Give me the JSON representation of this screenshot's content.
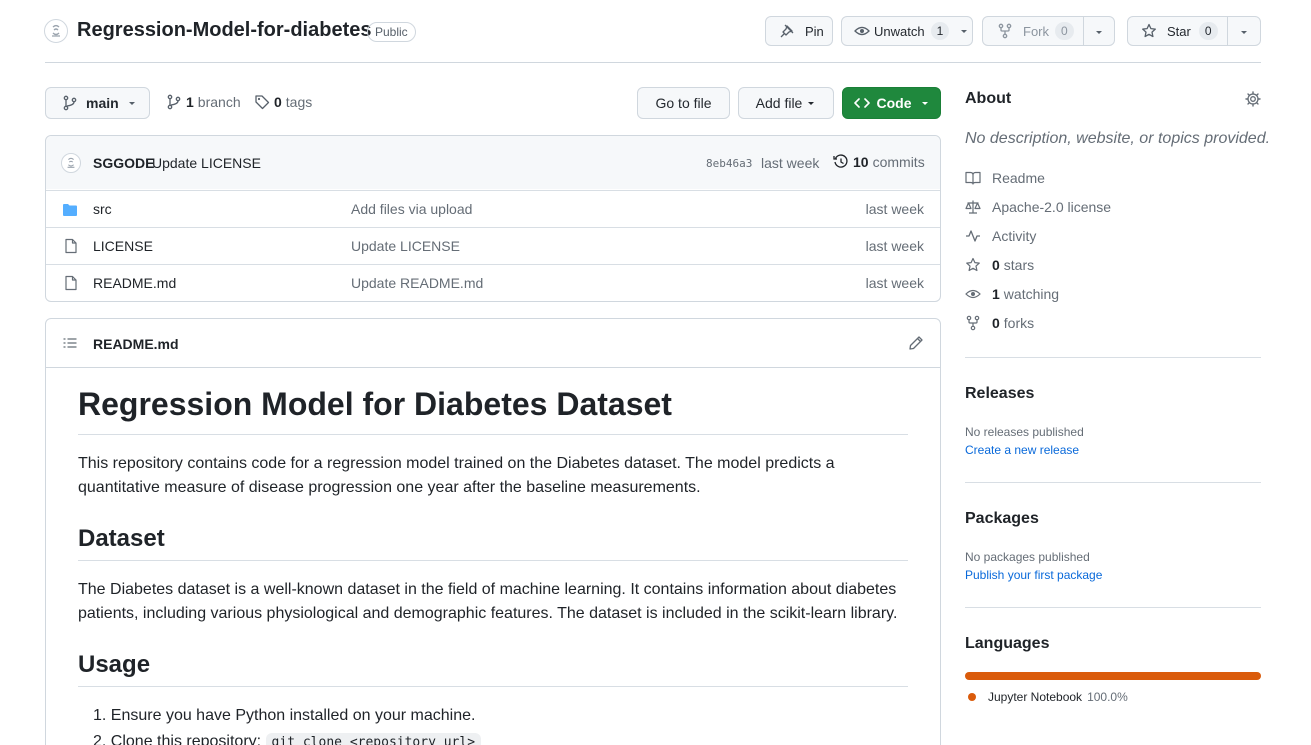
{
  "repo": {
    "name": "Regression-Model-for-diabetes",
    "visibility": "Public"
  },
  "header_actions": {
    "pin_label": "Pin",
    "unwatch_label": "Unwatch",
    "unwatch_count": "1",
    "fork_label": "Fork",
    "fork_count": "0",
    "star_label": "Star",
    "star_count": "0"
  },
  "toolbar": {
    "branch": "main",
    "branch_count": "1",
    "branch_label": "branch",
    "tag_count": "0",
    "tag_label": "tags",
    "go_to_file": "Go to file",
    "add_file": "Add file",
    "code": "Code"
  },
  "latest_commit": {
    "author": "SGGODE",
    "message": "Update LICENSE",
    "hash": "8eb46a3",
    "time": "last week",
    "commit_count": "10",
    "commit_label": "commits"
  },
  "files": [
    {
      "name": "src",
      "type": "folder",
      "message": "Add files via upload",
      "time": "last week"
    },
    {
      "name": "LICENSE",
      "type": "file",
      "message": "Update LICENSE",
      "time": "last week"
    },
    {
      "name": "README.md",
      "type": "file",
      "message": "Update README.md",
      "time": "last week"
    }
  ],
  "readme": {
    "filename": "README.md",
    "title": "Regression Model for Diabetes Dataset",
    "intro_line1": "This repository contains code for a regression model trained on the Diabetes dataset. The model predicts a",
    "intro_line2": "quantitative measure of disease progression one year after the baseline measurements.",
    "dataset_heading": "Dataset",
    "dataset_line1": "The Diabetes dataset is a well-known dataset in the field of machine learning. It contains information about diabetes",
    "dataset_line2": "patients, including various physiological and demographic features. The dataset is included in the scikit-learn library.",
    "usage_heading": "Usage",
    "steps": [
      {
        "num": "1.",
        "text": "Ensure you have Python installed on your machine."
      },
      {
        "num": "2.",
        "text": "Clone this repository:",
        "code": "git clone <repository_url>"
      }
    ]
  },
  "about": {
    "heading": "About",
    "description": "No description, website, or topics provided.",
    "readme": "Readme",
    "license": "Apache-2.0 license",
    "activity": "Activity",
    "stars_count": "0",
    "stars_label": "stars",
    "watching_count": "1",
    "watching_label": "watching",
    "forks_count": "0",
    "forks_label": "forks"
  },
  "releases": {
    "heading": "Releases",
    "empty": "No releases published",
    "link": "Create a new release"
  },
  "packages": {
    "heading": "Packages",
    "empty": "No packages published",
    "link": "Publish your first package"
  },
  "languages": {
    "heading": "Languages",
    "items": [
      {
        "name": "Jupyter Notebook",
        "percent": "100.0%",
        "fraction": 1.0,
        "color": "#DA5B0B"
      }
    ]
  },
  "colors": {
    "primary_green": "#1f883d",
    "link_blue": "#0969da",
    "folder_blue": "#54aeff",
    "jupyter_orange": "#DA5B0B"
  }
}
